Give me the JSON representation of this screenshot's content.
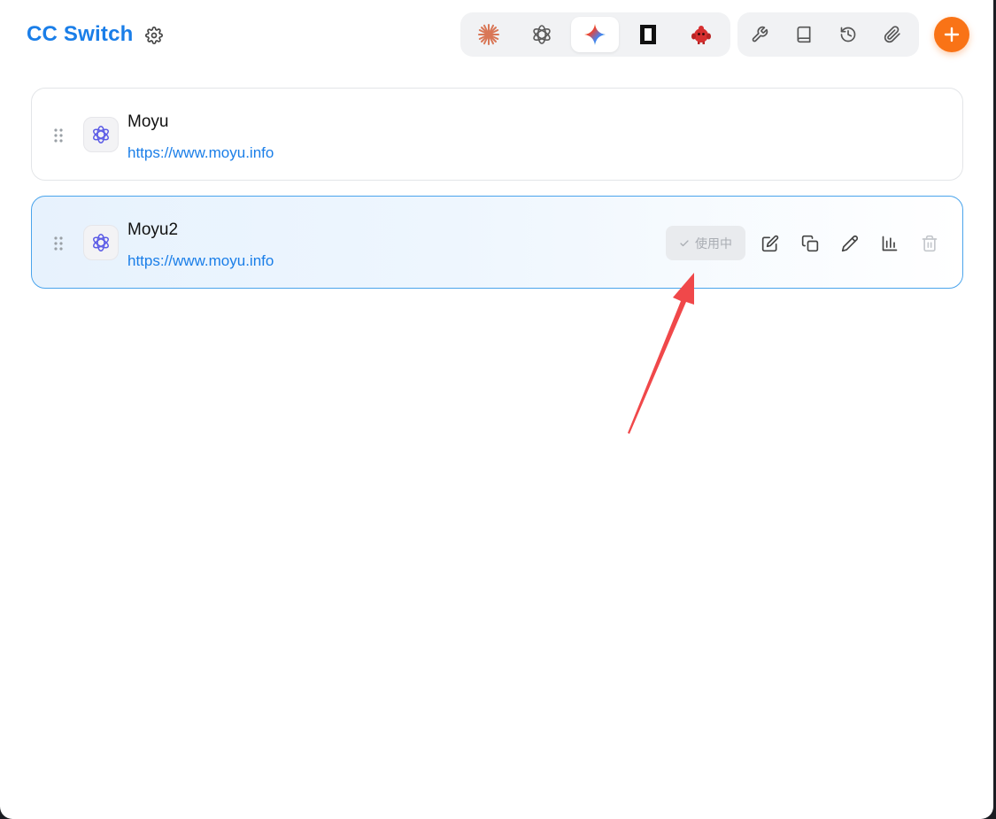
{
  "header": {
    "title": "CC Switch"
  },
  "app_switcher": [
    {
      "name": "claude",
      "icon": "claude-asterisk-icon",
      "color": "#d97757",
      "active": false
    },
    {
      "name": "codex",
      "icon": "openai-icon",
      "color": "#555555",
      "active": false
    },
    {
      "name": "gemini",
      "icon": "gemini-star-icon",
      "color": "#4f8ef7",
      "active": true
    },
    {
      "name": "terminal-app",
      "icon": "black-rectangle-icon",
      "color": "#111111",
      "active": false
    },
    {
      "name": "red-mascot-app",
      "icon": "red-mascot-icon",
      "color": "#d62f2f",
      "active": false
    }
  ],
  "tools": [
    {
      "name": "wrench",
      "icon": "wrench-icon"
    },
    {
      "name": "book",
      "icon": "book-icon"
    },
    {
      "name": "history",
      "icon": "history-icon"
    },
    {
      "name": "plugin",
      "icon": "paperclip-icon"
    }
  ],
  "providers": [
    {
      "name": "Moyu",
      "url": "https://www.moyu.info",
      "active": false
    },
    {
      "name": "Moyu2",
      "url": "https://www.moyu.info",
      "active": true,
      "status_label": "使用中"
    }
  ],
  "colors": {
    "accent": "#1a7ee8",
    "add_button": "#f97316",
    "annotation": "#f0484a"
  }
}
